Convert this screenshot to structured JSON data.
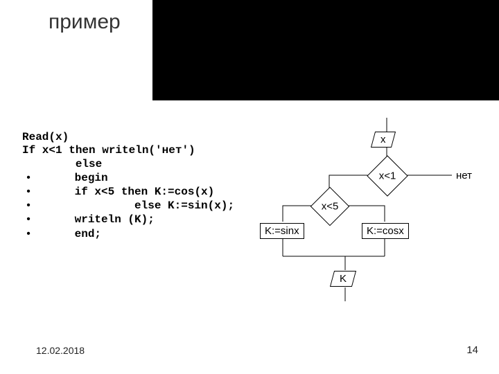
{
  "title": "пример",
  "code": {
    "l1": "Read(x)",
    "l2": "If x<1 then writeln('нет')",
    "l3": "        else",
    "l4": "      begin",
    "l5": "      if x<5 then K:=cos(x)",
    "l6": "               else K:=sin(x);",
    "l7": "      writeln (K);",
    "l8": "      end;"
  },
  "flow": {
    "input": "x",
    "cond1": "x<1",
    "cond2": "x<5",
    "no_label": "нет",
    "a1": "K:=sinx",
    "a2": "K:=cosx",
    "out": "K"
  },
  "footer": {
    "date": "12.02.2018",
    "page": "14"
  },
  "chart_data": {
    "type": "flowchart",
    "nodes": [
      {
        "id": "in",
        "kind": "io",
        "label": "x"
      },
      {
        "id": "c1",
        "kind": "decision",
        "label": "x<1"
      },
      {
        "id": "no",
        "kind": "terminal",
        "label": "нет"
      },
      {
        "id": "c2",
        "kind": "decision",
        "label": "x<5"
      },
      {
        "id": "s",
        "kind": "process",
        "label": "K:=sinx"
      },
      {
        "id": "co",
        "kind": "process",
        "label": "K:=cosx"
      },
      {
        "id": "out",
        "kind": "io",
        "label": "K"
      }
    ],
    "edges": [
      {
        "from": "in",
        "to": "c1"
      },
      {
        "from": "c1",
        "to": "no",
        "label": "true"
      },
      {
        "from": "c1",
        "to": "c2",
        "label": "false"
      },
      {
        "from": "c2",
        "to": "co",
        "label": "true"
      },
      {
        "from": "c2",
        "to": "s",
        "label": "false"
      },
      {
        "from": "s",
        "to": "out"
      },
      {
        "from": "co",
        "to": "out"
      }
    ]
  }
}
